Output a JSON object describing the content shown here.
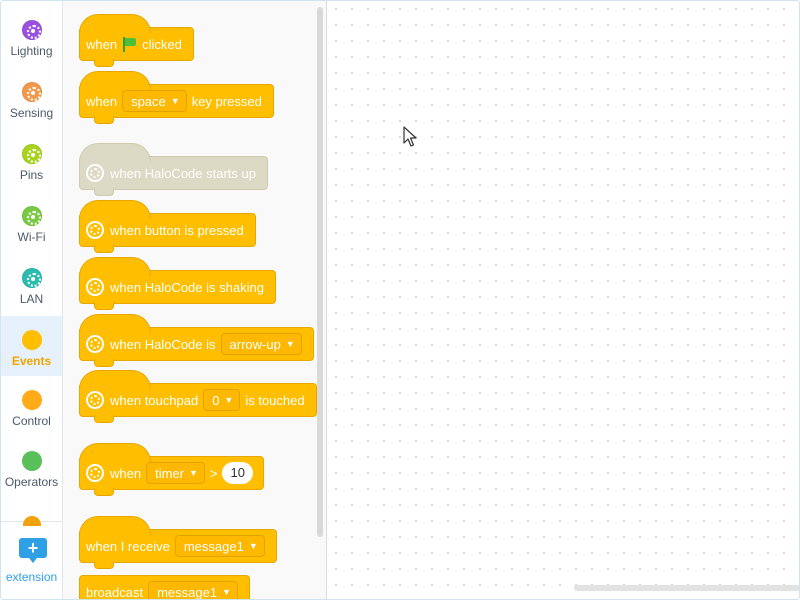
{
  "sidebar": {
    "categories": [
      {
        "label": "Lighting",
        "color": "#9b51e0",
        "icon": "halocode-gear-icon"
      },
      {
        "label": "Sensing",
        "color": "#f2994a",
        "icon": "halocode-gear-icon"
      },
      {
        "label": "Pins",
        "color": "#a8d41f",
        "icon": "halocode-gear-icon"
      },
      {
        "label": "Wi-Fi",
        "color": "#7ac943",
        "icon": "halocode-gear-icon"
      },
      {
        "label": "LAN",
        "color": "#2bbcb0",
        "icon": "halocode-gear-icon"
      },
      {
        "label": "Events",
        "color": "#ffbf00",
        "icon": "dot-icon",
        "active": true
      },
      {
        "label": "Control",
        "color": "#ffab19",
        "icon": "dot-icon"
      },
      {
        "label": "Operators",
        "color": "#59c059",
        "icon": "dot-icon"
      }
    ],
    "extension_label": "extension"
  },
  "palette": {
    "when_flag": {
      "pre": "when",
      "post": "clicked"
    },
    "when_key": {
      "pre": "when",
      "key": "space",
      "post": "key pressed"
    },
    "when_start": {
      "text": "when HaloCode starts up"
    },
    "when_button": {
      "text": "when button is pressed"
    },
    "when_shaking": {
      "text": "when HaloCode is shaking"
    },
    "when_is": {
      "pre": "when HaloCode is",
      "value": "arrow-up"
    },
    "when_touchpad": {
      "pre": "when touchpad",
      "value": "0",
      "post": "is touched"
    },
    "when_timer": {
      "pre": "when",
      "value": "timer",
      "op": ">",
      "number": "10"
    },
    "when_receive": {
      "pre": "when I receive",
      "value": "message1"
    },
    "broadcast": {
      "pre": "broadcast",
      "value": "message1"
    }
  },
  "colors": {
    "events": "#ffbf00",
    "disabled": "#dcd9c4",
    "extension": "#2f9fe6"
  }
}
